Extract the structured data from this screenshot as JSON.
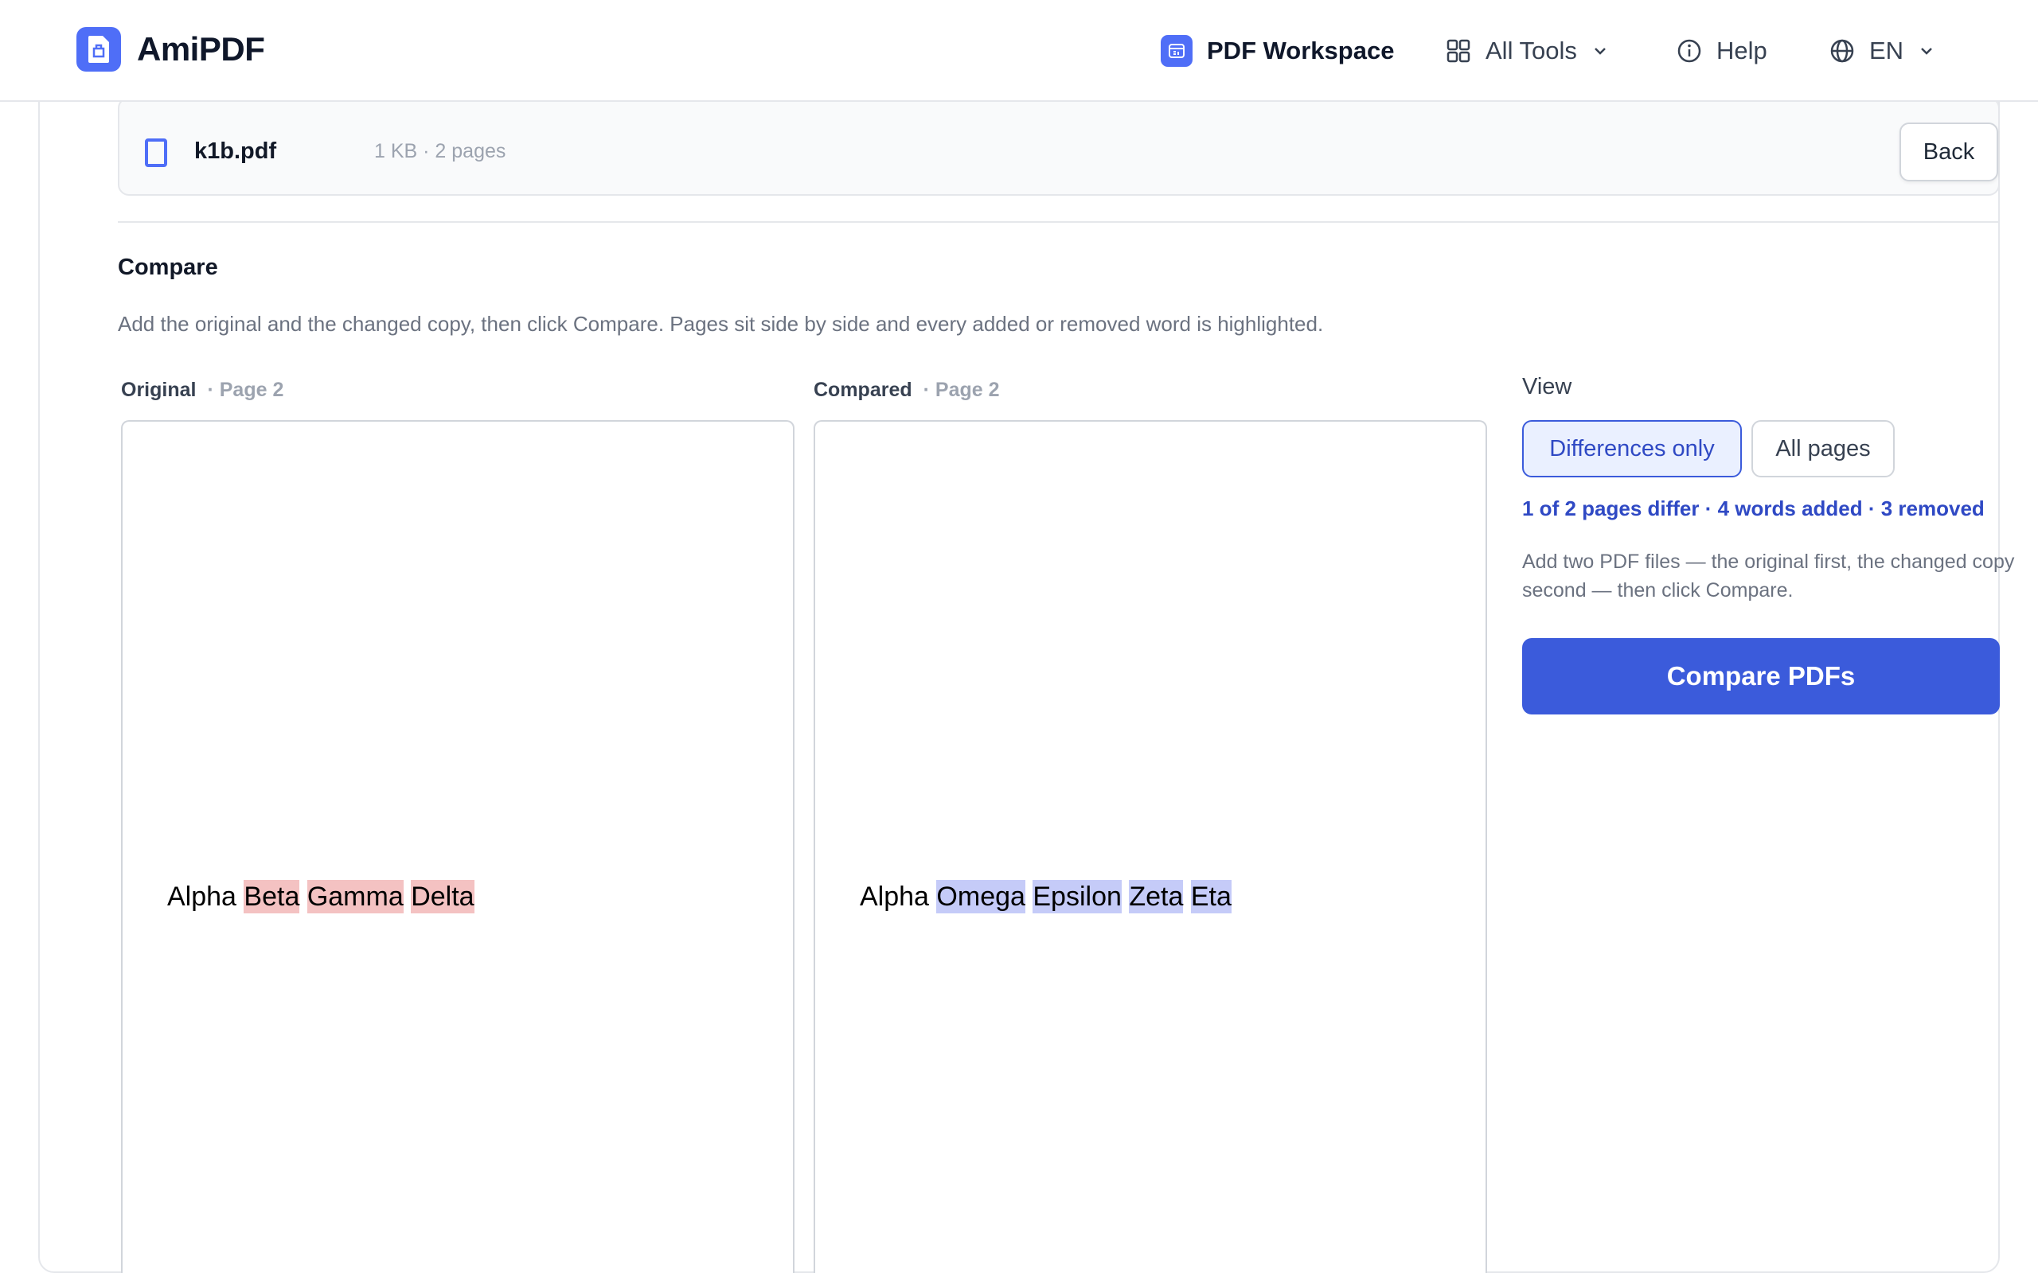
{
  "header": {
    "brand": "AmiPDF",
    "workspace_label": "PDF Workspace",
    "tools_label": "All Tools",
    "help_label": "Help",
    "lang_label": "EN"
  },
  "file": {
    "name": "k1b.pdf",
    "meta": "1 KB · 2 pages"
  },
  "back_label": "Back",
  "section": {
    "title": "Compare",
    "description": "Add the original and the changed copy, then click Compare. Pages sit side by side and every added or removed word is highlighted."
  },
  "original": {
    "label": "Original",
    "page_ref": "· Page 2",
    "words": [
      "Alpha",
      "Beta",
      "Gamma",
      "Delta"
    ]
  },
  "compared": {
    "label": "Compared",
    "page_ref": "· Page 2",
    "words": [
      "Alpha",
      "Omega",
      "Epsilon",
      "Zeta",
      "Eta"
    ]
  },
  "view": {
    "label": "View",
    "options": [
      "Differences only",
      "All pages"
    ],
    "selected": "Differences only"
  },
  "summary": "1 of 2 pages differ · 4 words added · 3 removed",
  "hint": "Add two PDF files — the original first, the changed copy second — then click Compare.",
  "compare_button": "Compare PDFs",
  "colors": {
    "accent": "#3b5bdb",
    "removed_highlight": "#f4c2c2",
    "added_highlight": "#c5cbf8"
  }
}
